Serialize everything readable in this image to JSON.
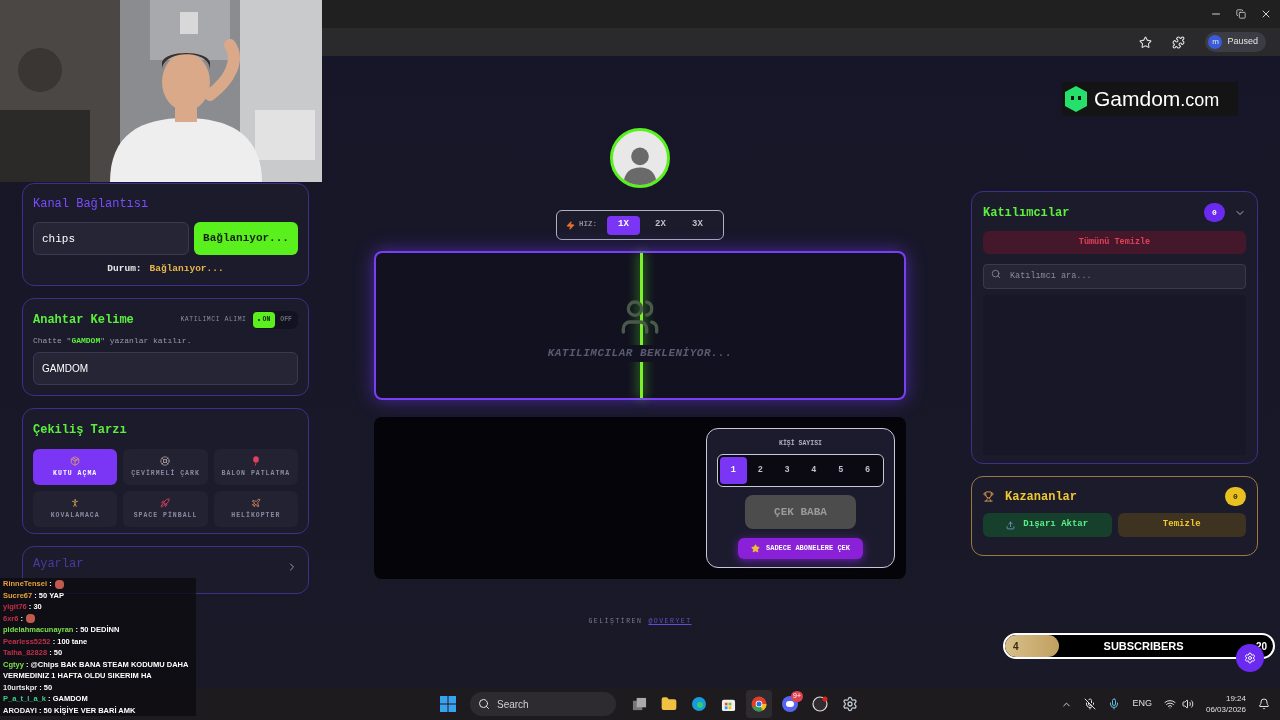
{
  "browser": {
    "profile_initial": "m",
    "profile_status": "Paused"
  },
  "logo": {
    "brand": "Gamdom",
    "suffix": ".com"
  },
  "channel": {
    "title": "Kanal Bağlantısı",
    "value": "chips",
    "button": "Bağlanıyor...",
    "status_label": "Durum:",
    "status": "Bağlanıyor..."
  },
  "keyword": {
    "title": "Anahtar Kelime",
    "toggle_label": "KATILIMCI ALIMI",
    "on_label": "ON",
    "off_label": "OFF",
    "on": true,
    "hint": "Chatte \"**GAMDOM**\" yazanlar katılır.",
    "value": "GAMDOM"
  },
  "draw_style": {
    "title": "Çekiliş Tarzı",
    "options": [
      {
        "label": "KUTU AÇMA",
        "selected": true
      },
      {
        "label": "ÇEVİRMELİ ÇARK",
        "selected": false
      },
      {
        "label": "BALON PATLATMA",
        "selected": false
      },
      {
        "label": "KOVALAMACA",
        "selected": false
      },
      {
        "label": "SPACE PİNBALL",
        "selected": false
      },
      {
        "label": "HELİKOPTER",
        "selected": false
      }
    ]
  },
  "settings": {
    "title": "Ayarlar"
  },
  "speed": {
    "label": "HIZ:",
    "options": [
      {
        "label": "1X",
        "selected": true
      },
      {
        "label": "2X",
        "selected": false
      },
      {
        "label": "3X",
        "selected": false
      }
    ]
  },
  "stage": {
    "empty_message": "KATILIMCILAR BEKLENİYOR..."
  },
  "picker": {
    "label": "KİŞİ SAYISI",
    "counts": [
      {
        "label": "1",
        "selected": true
      },
      {
        "label": "2",
        "selected": false
      },
      {
        "label": "3",
        "selected": false
      },
      {
        "label": "4",
        "selected": false
      },
      {
        "label": "5",
        "selected": false
      },
      {
        "label": "6",
        "selected": false
      }
    ],
    "draw_button": {
      "label": "ÇEK BABA",
      "disabled": true
    },
    "subs_button": "SADECE ABONELERE ÇEK"
  },
  "footer": {
    "text": "GELİŞTİREN",
    "link": "@OVERYET"
  },
  "participants": {
    "title": "Katılımcılar",
    "count": "0",
    "clear_button": "Tümünü Temizle",
    "search_placeholder": "Katılımcı ara..."
  },
  "winners": {
    "title": "Kazananlar",
    "count": "0",
    "export_button": "Dışarı Aktar",
    "clear_button": "Temizle"
  },
  "subscribers_goal": {
    "current": "4",
    "label": "SUBSCRIBERS",
    "target": "20",
    "level": 0.2
  },
  "chat": [
    {
      "user": "RinneTensei",
      "color": "#e6a23c",
      "kind": "emote",
      "text": ":"
    },
    {
      "user": "Sucre67",
      "color": "#e6a23c",
      "kind": "text",
      "text": ": 50 YAP"
    },
    {
      "user": "yigit76",
      "color": "#c0304a",
      "kind": "text",
      "text": ": 30"
    },
    {
      "user": "6xr6",
      "color": "#c0304a",
      "kind": "emote",
      "text": ":"
    },
    {
      "user": "pidelahmacunayran",
      "color": "#7ee04a",
      "kind": "text",
      "text": ": 50 DEDİNN"
    },
    {
      "user": "Pearless5252",
      "color": "#c0304a",
      "kind": "text",
      "text": ": 100 tane"
    },
    {
      "user": "Talha_82828",
      "color": "#c0304a",
      "kind": "text",
      "text": ": 50"
    },
    {
      "user": "Cgtyy",
      "color": "#7ee04a",
      "kind": "text",
      "text": ": @Chips BAK BANA STEAM KODUMU DAHA VERMEDINIZ 1 HAFTA OLDU SIKERIM HA"
    },
    {
      "user": "10urtskpr",
      "color": "#e8e8e8",
      "kind": "text",
      "text": ": 50"
    },
    {
      "user": "P_a_t_l_a_k",
      "color": "#3ccf8a",
      "kind": "text",
      "text": ": GAMDOM"
    },
    {
      "user": "ARODAYI",
      "color": "#f0f0f0",
      "kind": "text",
      "text": ": 50 KİŞİYE VER BARİ AMK"
    }
  ],
  "taskbar": {
    "search": "Search",
    "discord_badge": "9+",
    "language": "ENG",
    "time": "19:24",
    "date": "06/03/2026"
  }
}
